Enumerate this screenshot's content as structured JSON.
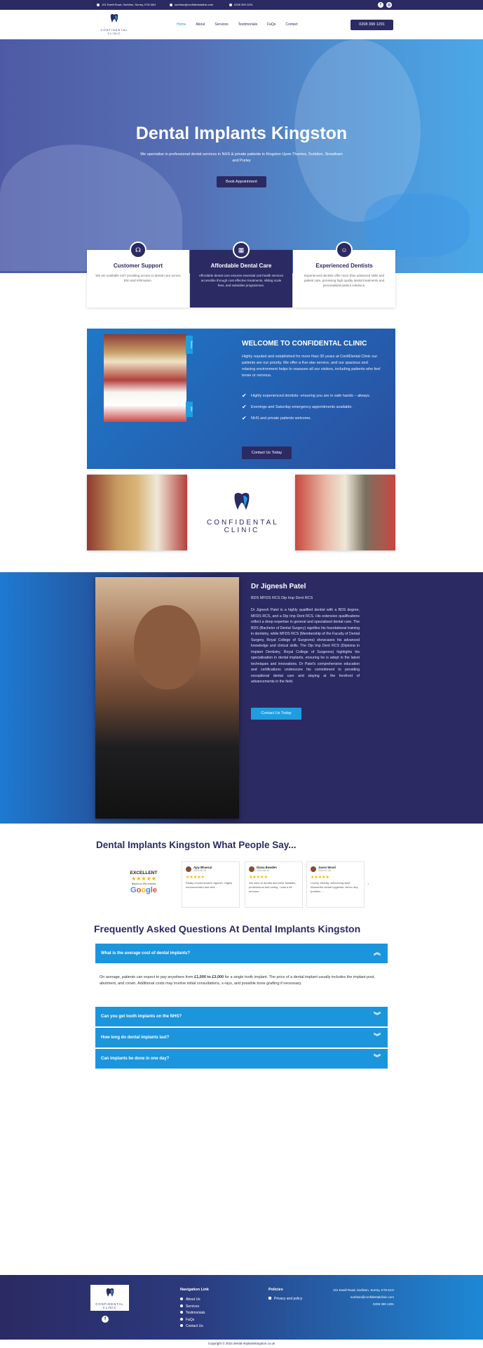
{
  "topbar": {
    "address": "101 Ewell Road, Surbiton, Surrey, KT6 6AH",
    "email": "surbiton@confidentalclinic.com",
    "phone": "0208 399 1291"
  },
  "header": {
    "logo_text": "CONFIDENTAL",
    "logo_sub": "CLINIC",
    "nav": [
      "Home",
      "About",
      "Services",
      "Testimonials",
      "FaQs",
      "Contact"
    ],
    "call_button": "0208 399 1291"
  },
  "hero": {
    "title": "Dental Implants Kingston",
    "subtitle": "We specialise in professional dental services in NHS & private patients in Kingston Upon Thames, Surbiton, Streatham and Purley",
    "button": "Book Appointment"
  },
  "features": [
    {
      "title": "Customer Support",
      "text": "We are available 24/7 providing access to dental care across Elm and Infirmation.",
      "icon": "headset-icon"
    },
    {
      "title": "Affordable Dental Care",
      "text": "Affordable dental care ensures essential oral health services accessible through cost effective treatments, sliding scale fees, and subsidies programmes.",
      "icon": "calendar-icon"
    },
    {
      "title": "Experienced Dentists",
      "text": "Experienced dentists offer more than advanced skills and patient care, promising high quality dental treatments and personalised patient solutions.",
      "icon": "dentist-icon"
    }
  ],
  "welcome": {
    "before_tag": "Before",
    "after_tag": "After",
    "title": "WELCOME TO CONFIDENTAL CLINIC",
    "intro": "Highly reputed and established for more than 30 years at ConfiDental Clinic our patients are our priority. We offer a five-star service, and our spacious and relaxing environment helps to reassure all our visitors, including patients who feel tense or nervous.",
    "points": [
      "Highly experienced dentists- ensuring you are in safe hands – always.",
      "Evenings and Saturday emergency appointments available.",
      "NHS and private patients welcome."
    ],
    "button": "Contact Us Today"
  },
  "center_logo": {
    "text": "CONFIDENTAL",
    "sub": "CLINIC"
  },
  "doctor": {
    "name": "Dr Jignesh Patel",
    "quals": "BDS MFDS RCS Dip Imp Dent RCS",
    "bio": "Dr Jignesh Patel is a highly qualified dentist with a BDS degree, MFDS RCS, and a Dip Imp Dent RCS. His extensive qualifications reflect a deep expertise in general and specialised dental care. The BDS (Bachelor of Dental Surgery) signifies his foundational training in dentistry, while MFDS RCS (Membership of the Faculty of Dental Surgery, Royal College of Surgeons) showcases his advanced knowledge and clinical skills. The Dip Imp Dent RCS (Diploma in Implant Dentistry, Royal College of Surgeons) highlights his specialisation in dental implants, ensuring he is adept in the latest techniques and innovations. Dr Patel's comprehensive education and certifications underscore his commitment to providing exceptional dental care and staying at the forefront of advancements in the field.",
    "button": "Contact Us Today"
  },
  "reviews": {
    "title": "Dental Implants Kingston What People Say...",
    "rating_label": "EXCELLENT",
    "stars": "★★★★★",
    "based_on": "Based on 254 reviews",
    "google": [
      "G",
      "o",
      "o",
      "g",
      "l",
      "e"
    ],
    "items": [
      {
        "name": "Ajay Bhavsar",
        "date": "2024-08-19",
        "stars": "★★★★★",
        "text": "Really recommended Jignesh. Highly recommended and well ..."
      },
      {
        "name": "Diana Bowden",
        "date": "2024-08-12",
        "stars": "★★★★★",
        "text": "We went to dentist and were fantastic, professional and caring. I was a bit nervous ..."
      },
      {
        "name": "Jason Wood",
        "date": "2024-07-26",
        "stars": "★★★★★",
        "text": "Lovely, friendly, welcoming staff. Wonderful dental hygienist. Never any problem ..."
      }
    ]
  },
  "faq": {
    "title": "Frequently Asked Questions At Dental Implants Kingston",
    "items": [
      {
        "q": "What is the average cost of dental implants?",
        "open": true
      },
      {
        "q": "Can you get tooth implants on the NHS?",
        "open": false
      },
      {
        "q": "How long do dental implants last?",
        "open": false
      },
      {
        "q": "Can implants be done in one day?",
        "open": false
      }
    ],
    "answer_pre": "On average, patients can expect to pay anywhere from ",
    "answer_bold": "£1,000 to £3,000",
    "answer_post": " for a single tooth implant. The price of a dental implant usually includes the implant post, abutment, and crown. Additional costs may involve initial consultations, x-rays, and possible bone grafting if necessary.",
    "chev_up": "︽",
    "chev_down": "︾"
  },
  "footer": {
    "logo_text": "CONFIDENTAL",
    "logo_sub": "CLINIC",
    "nav_title": "Navigation Link",
    "nav_links": [
      "About Us",
      "Services",
      "Testimonials",
      "FaQs",
      "Contact Us"
    ],
    "policies_title": "Policies",
    "policy": "Privacy and policy",
    "address": "101 Ewell Road, Surbiton, Surrey, KT6 6AH",
    "email": "surbiton@confidentalclinic.com",
    "phone": "0208 399 1291"
  },
  "copyright": "Copyright © 2024 dental-implantskingston.co.uk",
  "colors": {
    "navy": "#2b2a63",
    "blue": "#1b95dc",
    "accent": "#1e9ee0"
  }
}
